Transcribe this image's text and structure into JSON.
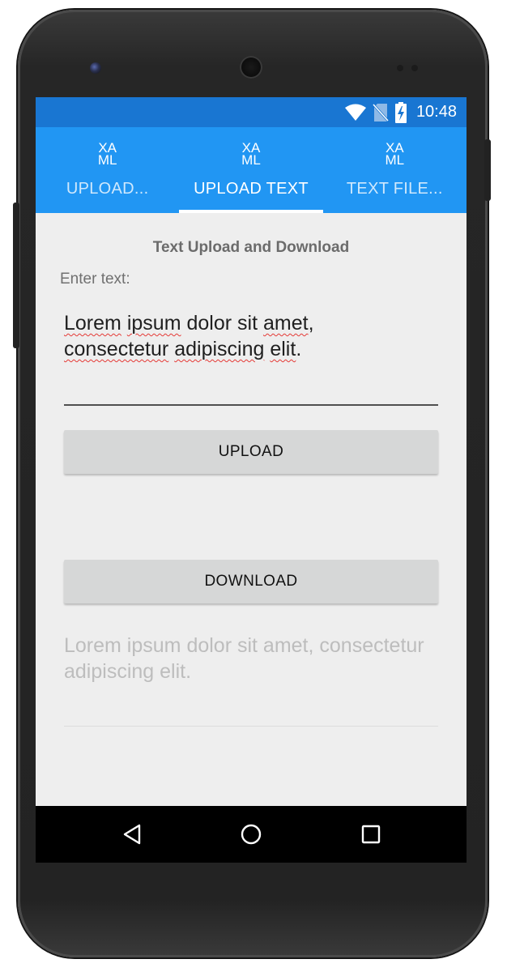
{
  "status_bar": {
    "time": "10:48",
    "icons": [
      "wifi-icon",
      "no-sim-icon",
      "battery-charging-icon"
    ],
    "color": "#1976d2"
  },
  "tabs": [
    {
      "icon_text_line1": "XA",
      "icon_text_line2": "ML",
      "label": "UPLOAD...",
      "active": false
    },
    {
      "icon_text_line1": "XA",
      "icon_text_line2": "ML",
      "label": "UPLOAD TEXT",
      "active": true
    },
    {
      "icon_text_line1": "XA",
      "icon_text_line2": "ML",
      "label": "TEXT FILE...",
      "active": false
    }
  ],
  "tab_bar_color": "#2196f3",
  "page": {
    "title": "Text Upload and Download",
    "input_label": "Enter text:",
    "input_value": "Lorem ipsum dolor sit amet, consectetur adipiscing elit.",
    "input_words": [
      {
        "text": "Lorem",
        "misspelled": true
      },
      {
        "text": "ipsum",
        "misspelled": true
      },
      {
        "text": "dolor",
        "misspelled": false
      },
      {
        "text": "sit",
        "misspelled": false
      },
      {
        "text": "amet",
        "misspelled": true,
        "suffix": ","
      },
      {
        "text": "consectetur",
        "misspelled": true
      },
      {
        "text": "adipiscing",
        "misspelled": true
      },
      {
        "text": "elit",
        "misspelled": true,
        "suffix": "."
      }
    ],
    "upload_button": "UPLOAD",
    "download_button": "DOWNLOAD",
    "downloaded_text": "Lorem ipsum dolor sit amet, consectetur adipiscing elit."
  },
  "nav_bar": {
    "buttons": [
      "back-icon",
      "home-icon",
      "recent-apps-icon"
    ]
  }
}
